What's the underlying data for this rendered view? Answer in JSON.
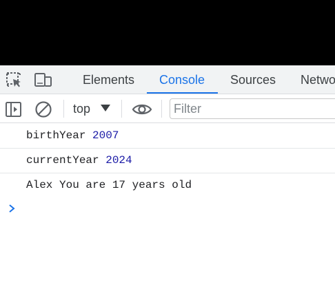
{
  "tabs": [
    {
      "label": "Elements",
      "active": false
    },
    {
      "label": "Console",
      "active": true
    },
    {
      "label": "Sources",
      "active": false
    },
    {
      "label": "Netwo",
      "active": false
    }
  ],
  "toolbar": {
    "context": "top",
    "filter_placeholder": "Filter"
  },
  "console": {
    "lines": [
      {
        "text": "birthYear ",
        "value": "2007"
      },
      {
        "text": "currentYear ",
        "value": "2024"
      },
      {
        "text": "Alex You are 17 years old",
        "value": ""
      }
    ]
  },
  "icons": {
    "inspect": "inspect-element-icon",
    "device": "device-toolbar-icon",
    "sidebar": "show-console-sidebar-icon",
    "clear": "clear-console-icon",
    "eye": "live-expression-eye-icon",
    "prompt": "console-prompt-chevron-icon"
  },
  "colors": {
    "accent": "#1a73e8",
    "number": "#1a1aa6"
  }
}
